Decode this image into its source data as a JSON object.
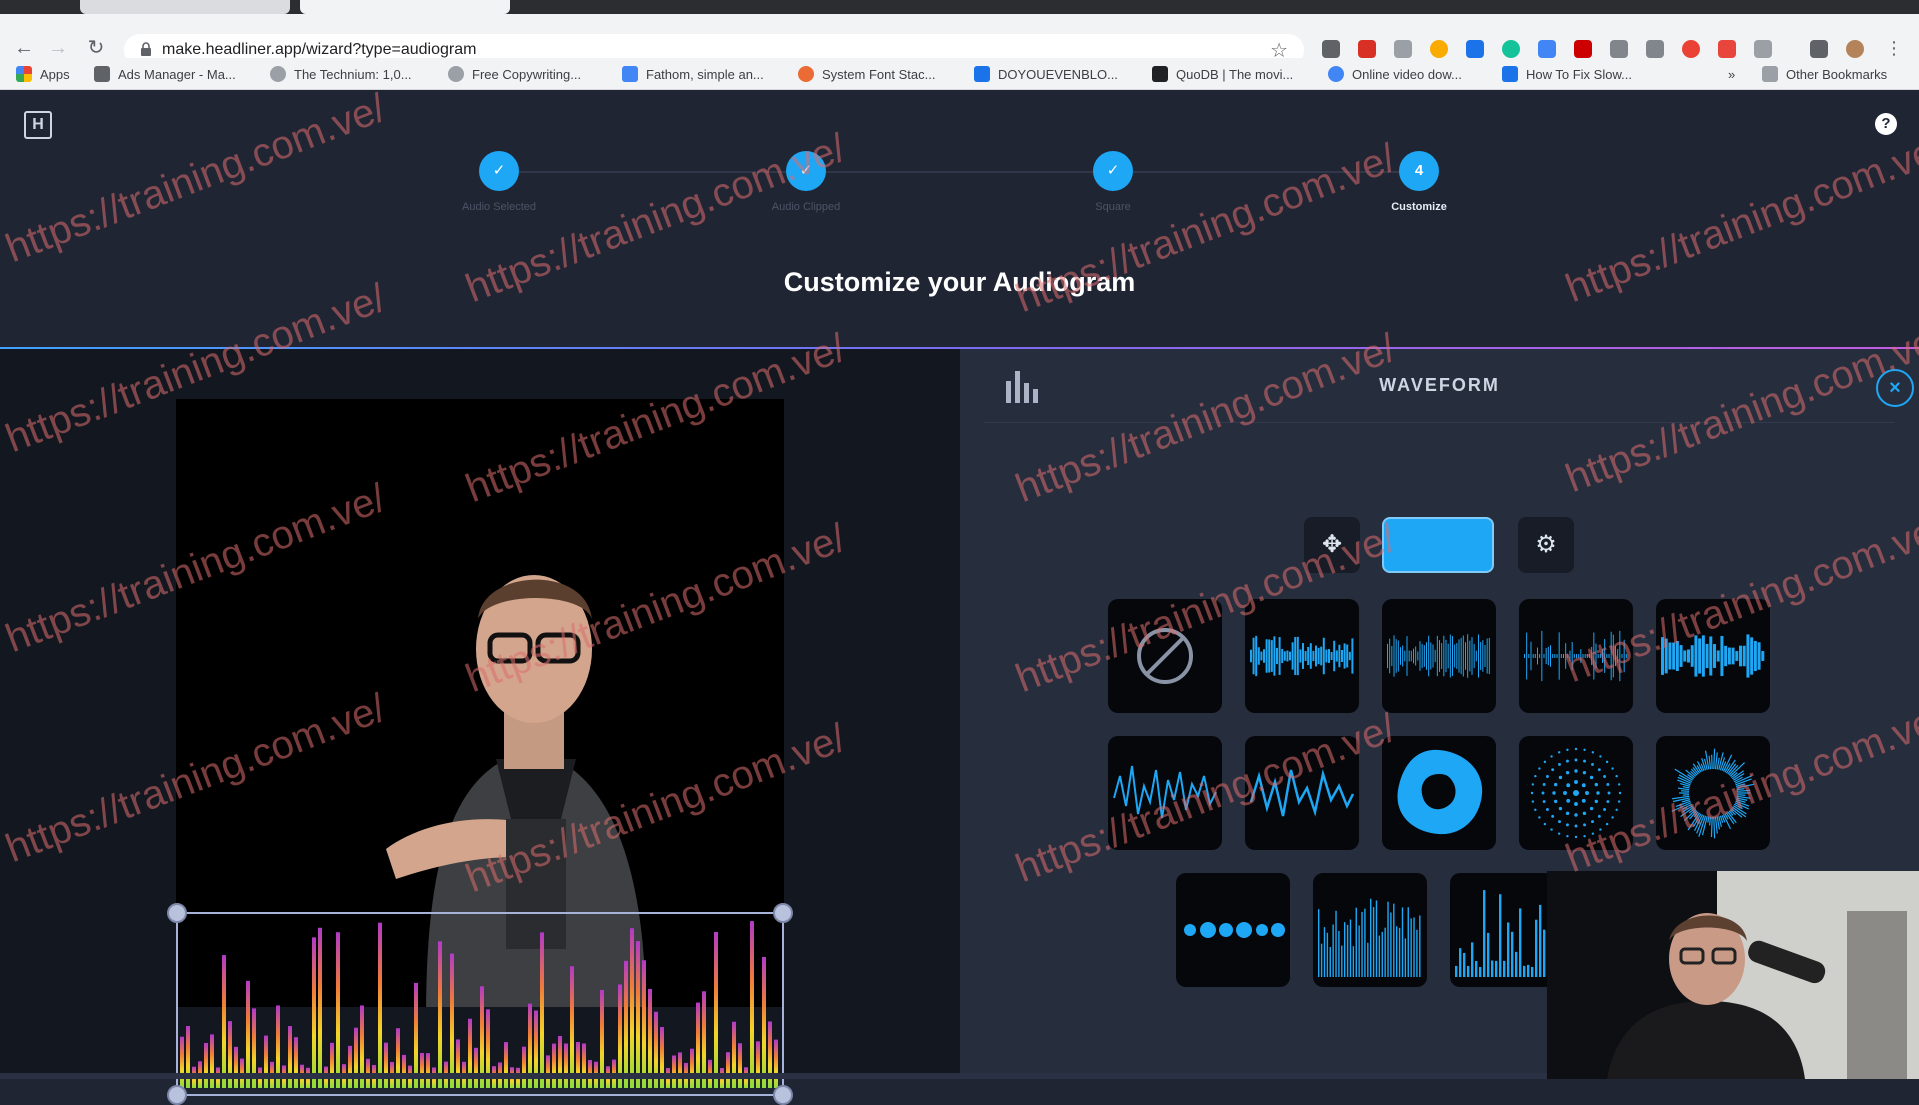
{
  "browser": {
    "url": "make.headliner.app/wizard?type=audiogram",
    "bookmarks": [
      {
        "label": "Apps",
        "color": "#ea4335"
      },
      {
        "label": "Ads Manager - Ma...",
        "color": "#5f6368"
      },
      {
        "label": "The Technium: 1,0...",
        "color": "#9aa0a6"
      },
      {
        "label": "Free Copywriting...",
        "color": "#9aa0a6"
      },
      {
        "label": "Fathom, simple an...",
        "color": "#4285f4"
      },
      {
        "label": "System Font Stac...",
        "color": "#ea6c34"
      },
      {
        "label": "DOYOUEVENBLO...",
        "color": "#1a73e8"
      },
      {
        "label": "QuoDB | The movi...",
        "color": "#202124"
      },
      {
        "label": "Online video dow...",
        "color": "#4285f4"
      },
      {
        "label": "How To Fix Slow...",
        "color": "#1a73e8"
      }
    ],
    "bookmark_overflow": "»",
    "other_bookmarks": "Other Bookmarks"
  },
  "wizard": {
    "steps": [
      {
        "label": "Audio Selected",
        "state": "done"
      },
      {
        "label": "Audio Clipped",
        "state": "done"
      },
      {
        "label": "Square",
        "state": "done"
      },
      {
        "label": "Customize",
        "number": "4",
        "state": "active"
      }
    ],
    "heading": "Customize your Audiogram"
  },
  "panel": {
    "title": "WAVEFORM",
    "close_icon": "close-icon",
    "accent_color": "#1ea7f5",
    "waveforms": [
      "none-icon",
      "bars-wave",
      "thin-lines-wave",
      "sparse-lines-wave",
      "thick-bars-wave",
      "line-wave",
      "line-wave-2",
      "blob-wave",
      "dots-radial-wave",
      "radial-lines-wave",
      "dots-row-wave",
      "vertical-bars-wave",
      "equalizer-wave"
    ]
  },
  "watermark": "https://training.com.ve/",
  "colors": {
    "app_bg": "#1f2533",
    "panel_bg": "#262d3d",
    "accent": "#1ea7f5"
  }
}
